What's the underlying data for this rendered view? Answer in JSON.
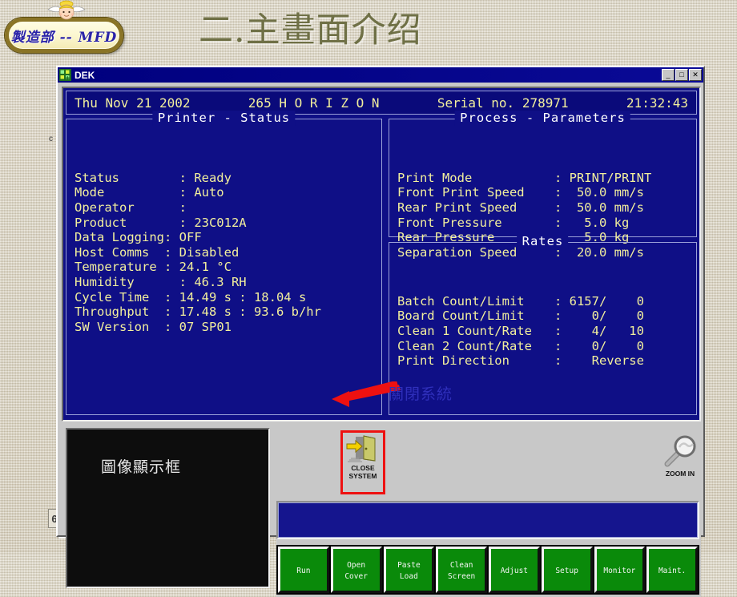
{
  "slide": {
    "title": "二.主畫面介绍",
    "logo_text": "製造部 -- MFD",
    "logo_icon": "angel-icon",
    "margin_mark_left": "c",
    "page_number": "6"
  },
  "window": {
    "title": "DEK",
    "icon": "dek-app-icon",
    "minimize_label": "_",
    "maximize_label": "□",
    "close_label": "✕"
  },
  "statusbar": {
    "date": "Thu Nov 21 2002",
    "machine": "265  H O R I Z O N",
    "serial": "Serial no. 278971",
    "time": "21:32:43"
  },
  "printer_status": {
    "legend": "Printer - Status",
    "rows": [
      {
        "key": "Status        : ",
        "value": "Ready"
      },
      {
        "key": "Mode          : ",
        "value": "Auto"
      },
      {
        "key": "Operator      : ",
        "value": ""
      },
      {
        "key": "Product       : ",
        "value": "23C012A"
      },
      {
        "key": "Data Logging: ",
        "value": "OFF"
      },
      {
        "key": "Host Comms  : ",
        "value": "Disabled"
      },
      {
        "key": "Temperature : ",
        "value": "24.1 °C"
      },
      {
        "key": "Humidity      : ",
        "value": "46.3 RH"
      },
      {
        "key": "Cycle Time  : ",
        "value": "14.49 s : 18.04 s"
      },
      {
        "key": "Throughput  : ",
        "value": "17.48 s : 93.6 b/hr"
      },
      {
        "key": "SW Version  : ",
        "value": "07 SP01"
      }
    ]
  },
  "process_parameters": {
    "legend": "Process - Parameters",
    "rows": [
      {
        "key": "Print Mode           : ",
        "value": "PRINT/PRINT"
      },
      {
        "key": "Front Print Speed    : ",
        "value": " 50.0 mm/s"
      },
      {
        "key": "Rear Print Speed     : ",
        "value": " 50.0 mm/s"
      },
      {
        "key": "Front Pressure       : ",
        "value": "  5.0 kg"
      },
      {
        "key": "Rear Pressure        : ",
        "value": "  5.0 kg"
      },
      {
        "key": "Separation Speed     : ",
        "value": " 20.0 mm/s"
      }
    ]
  },
  "rates": {
    "legend": "Rates",
    "rows": [
      {
        "key": "Batch Count/Limit    : ",
        "value": "6157/    0"
      },
      {
        "key": "Board Count/Limit    : ",
        "value": "   0/    0"
      },
      {
        "key": "Clean 1 Count/Rate   : ",
        "value": "   4/   10"
      },
      {
        "key": "Clean 2 Count/Rate   : ",
        "value": "   0/    0"
      },
      {
        "key": "Print Direction      : ",
        "value": "   Reverse"
      }
    ]
  },
  "image_panel": {
    "label": "圖像顯示框"
  },
  "tools": {
    "close_system": {
      "icon": "exit-door-icon",
      "line1": "CLOSE",
      "line2": "SYSTEM",
      "highlight_color": "#ee1111"
    },
    "zoom_in": {
      "icon": "magnifier-icon",
      "label": "ZOOM IN"
    }
  },
  "message_bar": {
    "text": ""
  },
  "function_buttons": [
    {
      "line1": "Run",
      "line2": ""
    },
    {
      "line1": "Open",
      "line2": "Cover"
    },
    {
      "line1": "Paste",
      "line2": "Load"
    },
    {
      "line1": "Clean",
      "line2": "Screen"
    },
    {
      "line1": "Adjust",
      "line2": ""
    },
    {
      "line1": "Setup",
      "line2": ""
    },
    {
      "line1": "Monitor",
      "line2": ""
    },
    {
      "line1": "Maint.",
      "line2": ""
    }
  ],
  "annotation": {
    "text": "關閉系統",
    "arrow_color": "#ee1111",
    "text_color": "#2f2fbb"
  },
  "colors": {
    "terminal_bg": "#0f0f86",
    "terminal_text": "#f2ef9d",
    "panel_border": "#9aa0d8",
    "button_green": "#0a8a0a",
    "title_bar": "#00007e",
    "slide_title": "#6f7046"
  }
}
